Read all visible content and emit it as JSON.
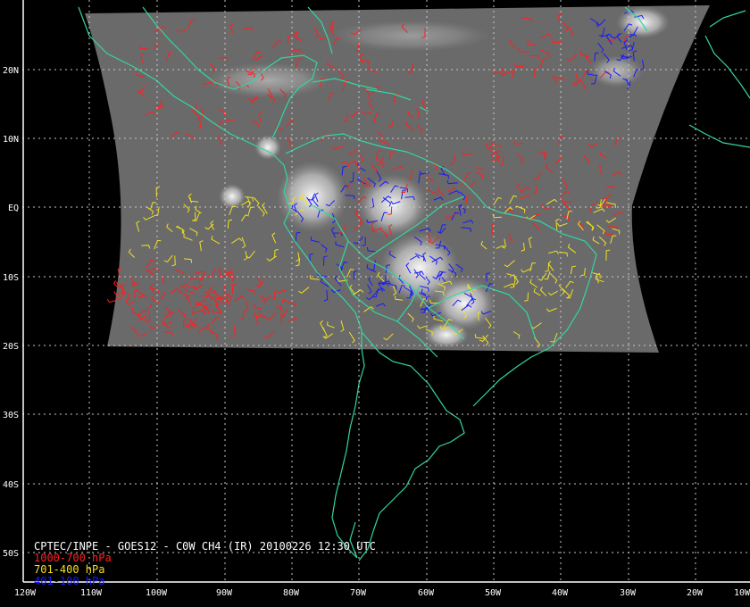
{
  "map": {
    "caption": "CPTEC/INPE - GOES12 - C0W CH4 (IR) 20100226 12:30 UTC",
    "legend": [
      {
        "label": "1000-700 hPa",
        "color": "#ff2020"
      },
      {
        "label": "701-400 hPa",
        "color": "#f0e020"
      },
      {
        "label": "401-100 hPa",
        "color": "#1a1aff"
      }
    ],
    "lon_ticks": [
      "120W",
      "110W",
      "100W",
      "90W",
      "80W",
      "70W",
      "60W",
      "50W",
      "40W",
      "30W",
      "20W",
      "10W"
    ],
    "lat_ticks": [
      "20N",
      "10N",
      "EQ",
      "10S",
      "20S",
      "30S",
      "40S",
      "50S"
    ],
    "colors": {
      "coast": "#33d6a0",
      "grid": "#c8c8c8",
      "background": "#000000",
      "imagery": "#6e6e6e"
    }
  }
}
